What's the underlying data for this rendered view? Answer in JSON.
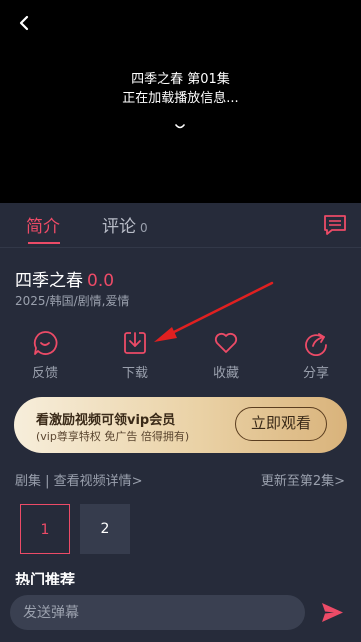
{
  "player": {
    "episode_title": "四季之春 第01集",
    "status_text": "正在加载播放信息..."
  },
  "tabs": {
    "intro": "简介",
    "comment": "评论",
    "comment_count": "0"
  },
  "show": {
    "title": "四季之春",
    "score": "0.0",
    "meta": "2025/韩国/剧情,爱情"
  },
  "actions": [
    {
      "label": "反馈",
      "icon": "feedback-icon"
    },
    {
      "label": "下载",
      "icon": "download-icon"
    },
    {
      "label": "收藏",
      "icon": "heart-icon"
    },
    {
      "label": "分享",
      "icon": "share-icon"
    }
  ],
  "vip_banner": {
    "title": "看激励视频可领vip会员",
    "subtitle": "(vip尊享特权 免广告 倍得拥有)",
    "button": "立即观看"
  },
  "episodes": {
    "left_label": "剧集 | 查看视频详情>",
    "right_label": "更新至第2集>",
    "items": [
      "1",
      "2"
    ]
  },
  "hot": {
    "title": "热门推荐"
  },
  "danmaku": {
    "placeholder": "发送弹幕"
  },
  "colors": {
    "accent": "#ec4b67",
    "background": "#262b3a",
    "player_bg": "#000000"
  }
}
